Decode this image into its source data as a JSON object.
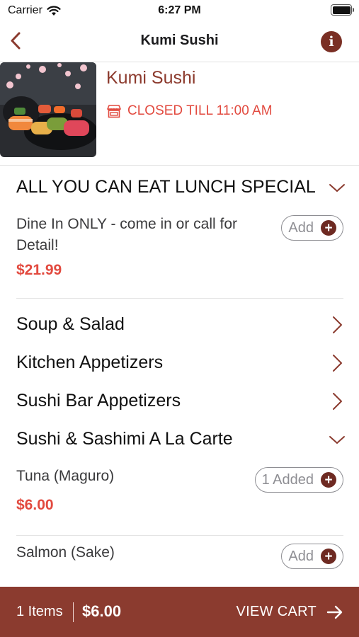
{
  "status_bar": {
    "carrier": "Carrier",
    "time": "6:27 PM"
  },
  "nav": {
    "title": "Kumi Sushi",
    "back_icon": "chevron-left-icon",
    "info_icon": "info-icon"
  },
  "restaurant": {
    "name": "Kumi Sushi",
    "status": "CLOSED TILL 11:00 AM",
    "status_icon": "storefront-icon"
  },
  "menu": {
    "lunch_special": {
      "title": "ALL YOU CAN EAT LUNCH SPECIAL",
      "item": {
        "name": "Dine In ONLY - come in or call for Detail!",
        "price": "$21.99",
        "button": "Add"
      }
    },
    "categories": [
      "Soup & Salad",
      "Kitchen Appetizers",
      "Sushi Bar Appetizers"
    ],
    "sushi_section": {
      "title": "Sushi & Sashimi A La Carte",
      "items": [
        {
          "name": "Tuna (Maguro)",
          "price": "$6.00",
          "button": "1 Added"
        },
        {
          "name": "Salmon (Sake)",
          "button": "Add"
        }
      ]
    }
  },
  "cart": {
    "items": "1 Items",
    "total": "$6.00",
    "view_cart": "VIEW CART"
  },
  "colors": {
    "brand": "#8b3b2f",
    "accent_red": "#e24a3f",
    "plus_button": "#6e2a22"
  }
}
